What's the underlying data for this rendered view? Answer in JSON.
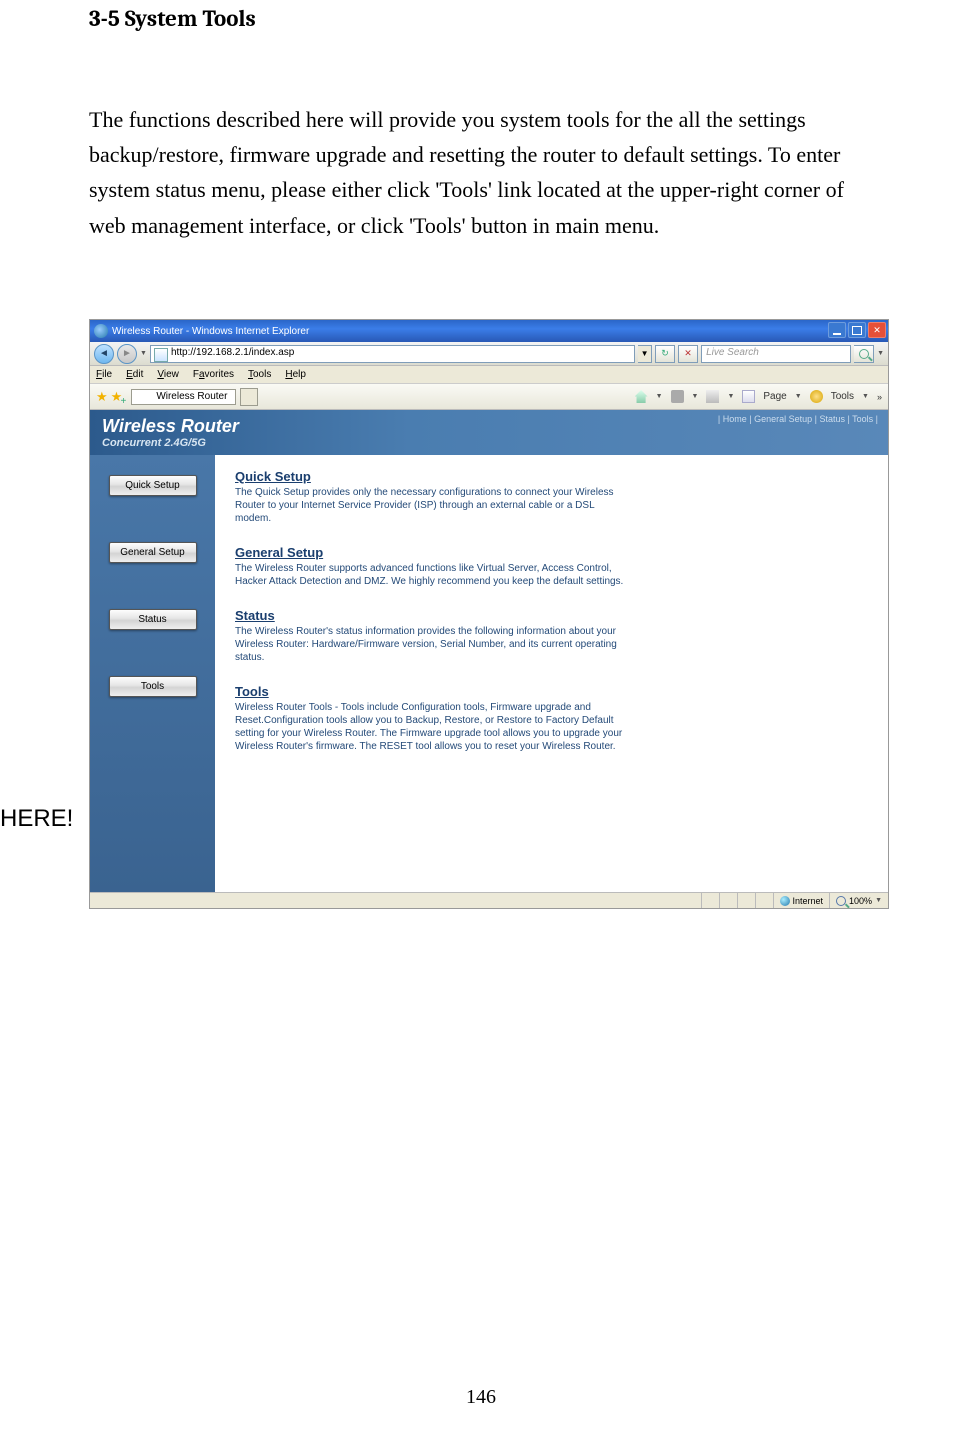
{
  "doc": {
    "heading": "3-5 System Tools",
    "body": "The functions described here will provide you system tools for the all the settings backup/restore, firmware upgrade and resetting the router to default settings. To enter system status menu, please either click 'Tools' link located at the upper-right corner of web management interface, or click 'Tools' button in main menu.",
    "callout": "HERE!",
    "page_number": "146"
  },
  "browser": {
    "title": "Wireless Router - Windows Internet Explorer",
    "address": "http://192.168.2.1/index.asp",
    "menus": {
      "file": "File",
      "edit": "Edit",
      "view": "View",
      "favorites": "Favorites",
      "tools": "Tools",
      "help": "Help"
    },
    "tab_name": "Wireless Router",
    "search_placeholder": "Live Search",
    "toolbar": {
      "page": "Page",
      "tools": "Tools"
    },
    "status": {
      "zone": "Internet",
      "zoom": "100%"
    }
  },
  "router": {
    "title": "Wireless Router",
    "subtitle": "Concurrent 2.4G/5G",
    "topnav": "| Home | General Setup | Status | Tools |",
    "sidebar": {
      "quick_setup": "Quick Setup",
      "general_setup": "General Setup",
      "status": "Status",
      "tools": "Tools"
    },
    "sections": {
      "quick": {
        "title": "Quick Setup",
        "text": "The Quick Setup provides only the necessary configurations to connect your Wireless Router to your Internet Service Provider (ISP) through an external cable or a DSL modem."
      },
      "general": {
        "title": "General Setup",
        "text": "The Wireless Router supports advanced functions like Virtual Server, Access Control, Hacker Attack Detection and DMZ. We highly recommend you keep the default settings."
      },
      "status": {
        "title": "Status",
        "text": "The Wireless Router's status information provides the following information about your Wireless Router: Hardware/Firmware version, Serial Number, and its current operating status."
      },
      "tools": {
        "title": "Tools",
        "text": "Wireless Router Tools - Tools include Configuration tools, Firmware upgrade and Reset.Configuration tools allow you to Backup, Restore, or Restore to Factory Default setting for your Wireless Router. The Firmware upgrade tool allows you to upgrade your Wireless Router's firmware. The RESET tool allows you to reset your Wireless Router."
      }
    }
  }
}
